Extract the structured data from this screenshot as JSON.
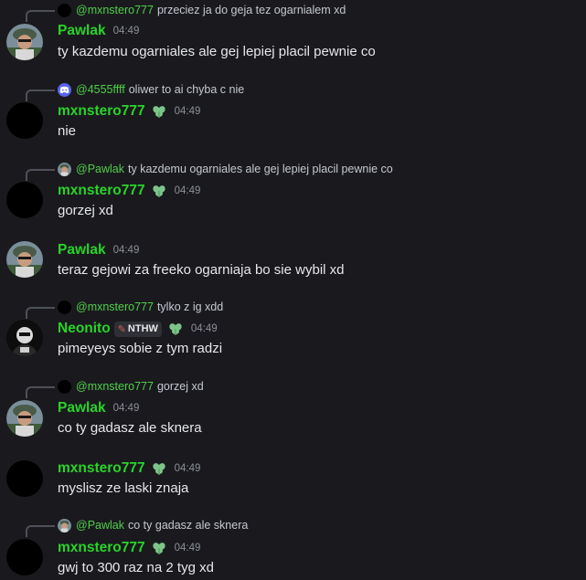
{
  "messages": [
    {
      "reply": {
        "name": "@mxnstero777",
        "text": "przeciez ja do geja tez ogarnialem xd",
        "avatar": "black"
      },
      "author": "Pawlak",
      "time": "04:49",
      "avatar": "pawlak",
      "badge": false,
      "tag": null,
      "content": "ty kazdemu ogarniales ale gej lepiej placil pewnie co"
    },
    {
      "reply": {
        "name": "@4555ffff",
        "text": "oliwer to ai chyba c nie",
        "avatar": "discord"
      },
      "author": "mxnstero777",
      "time": "04:49",
      "avatar": "black",
      "badge": true,
      "tag": null,
      "content": "nie"
    },
    {
      "reply": {
        "name": "@Pawlak",
        "text": "ty kazdemu ogarniales ale gej lepiej placil pewnie co",
        "avatar": "pawlak"
      },
      "author": "mxnstero777",
      "time": "04:49",
      "avatar": "black",
      "badge": true,
      "tag": null,
      "content": "gorzej xd"
    },
    {
      "reply": null,
      "author": "Pawlak",
      "time": "04:49",
      "avatar": "pawlak",
      "badge": false,
      "tag": null,
      "content": "teraz gejowi za freeko ogarniaja bo sie wybil xd"
    },
    {
      "reply": {
        "name": "@mxnstero777",
        "text": "tylko z ig xdd",
        "avatar": "black"
      },
      "author": "Neonito",
      "time": "04:49",
      "avatar": "neonito",
      "badge": true,
      "tag": "NTHW",
      "content": "pimeyeys sobie z tym radzi"
    },
    {
      "reply": {
        "name": "@mxnstero777",
        "text": "gorzej xd",
        "avatar": "black"
      },
      "author": "Pawlak",
      "time": "04:49",
      "avatar": "pawlak",
      "badge": false,
      "tag": null,
      "content": "co ty gadasz ale sknera"
    },
    {
      "reply": null,
      "author": "mxnstero777",
      "time": "04:49",
      "avatar": "black",
      "badge": true,
      "tag": null,
      "content": "myslisz ze laski znaja"
    },
    {
      "reply": {
        "name": "@Pawlak",
        "text": "co ty gadasz ale sknera",
        "avatar": "pawlak"
      },
      "author": "mxnstero777",
      "time": "04:49",
      "avatar": "black",
      "badge": true,
      "tag": null,
      "content": "gwj to 300 raz na 2 tyg xd"
    }
  ],
  "colors": {
    "background": "#1a1a1e",
    "username": "#29d329",
    "reply_name": "#4fcf4a",
    "timestamp": "#8b8f96"
  },
  "icons": {
    "badge": "clover-leaf-icon",
    "tag_icon": "knife-icon"
  }
}
